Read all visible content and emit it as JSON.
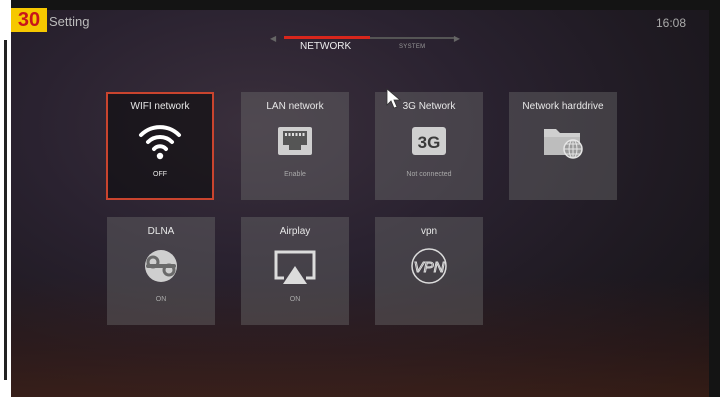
{
  "header": {
    "badge": "30",
    "title": "Setting",
    "clock": "16:08"
  },
  "tabs": [
    {
      "label": "NETWORK",
      "active": true
    },
    {
      "label": "SYSTEM",
      "active": false
    }
  ],
  "tiles": [
    {
      "label": "WIFI network",
      "status": "OFF",
      "icon": "wifi-icon",
      "selected": true
    },
    {
      "label": "LAN network",
      "status": "Enable",
      "icon": "ethernet-port-icon"
    },
    {
      "label": "3G Network",
      "status": "Not connected",
      "icon": "3g-icon",
      "icon_text": "3G"
    },
    {
      "label": "Network harddrive",
      "status": "",
      "icon": "network-folder-icon"
    },
    {
      "label": "DLNA",
      "status": "ON",
      "icon": "dlna-icon"
    },
    {
      "label": "Airplay",
      "status": "ON",
      "icon": "airplay-icon"
    },
    {
      "label": "vpn",
      "status": "",
      "icon": "vpn-icon",
      "icon_text": "VPN"
    }
  ],
  "colors": {
    "accent": "#d7261c",
    "selected_border": "#c9442e",
    "badge_bg": "#f6c800",
    "badge_text": "#c8151b"
  }
}
